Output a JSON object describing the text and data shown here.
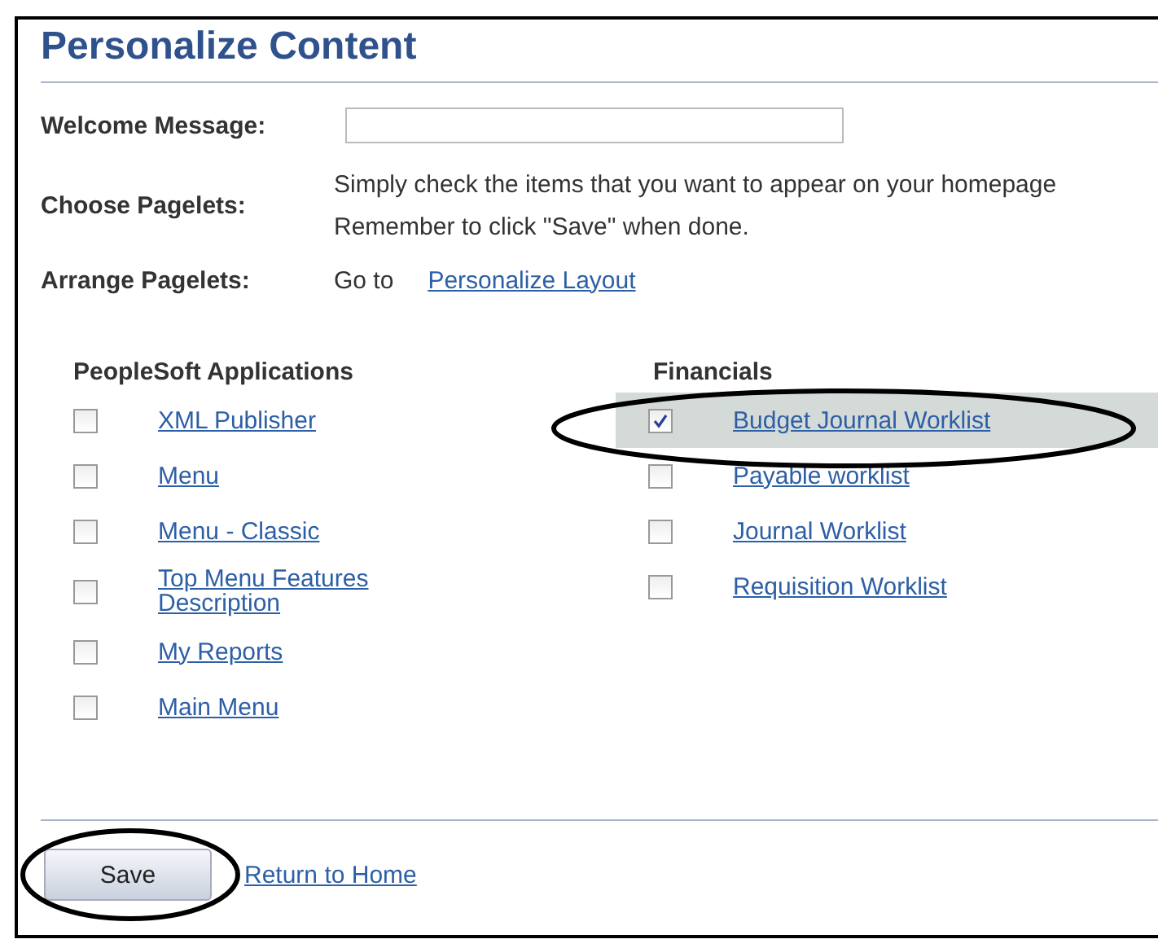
{
  "title": "Personalize Content",
  "welcome": {
    "label": "Welcome Message:"
  },
  "choose": {
    "label": "Choose Pagelets:",
    "lines": [
      "Simply check the items that you want to appear on your homepage",
      "Remember to click \"Save\" when done."
    ]
  },
  "arrange": {
    "label": "Arrange Pagelets:",
    "prefix": "Go to",
    "link": "Personalize Layout"
  },
  "columns": [
    {
      "heading": "PeopleSoft Applications",
      "items": [
        {
          "label": "XML Publisher",
          "checked": false
        },
        {
          "label": "Menu",
          "checked": false
        },
        {
          "label": "Menu - Classic",
          "checked": false
        },
        {
          "label": "Top Menu Features Description",
          "checked": false
        },
        {
          "label": "My Reports",
          "checked": false
        },
        {
          "label": "Main Menu",
          "checked": false
        }
      ]
    },
    {
      "heading": "Financials",
      "items": [
        {
          "label": "Budget Journal Worklist",
          "checked": true
        },
        {
          "label": "Payable worklist",
          "checked": false
        },
        {
          "label": "Journal Worklist",
          "checked": false
        },
        {
          "label": "Requisition Worklist",
          "checked": false
        }
      ]
    }
  ],
  "buttons": {
    "save": "Save",
    "return": "Return to Home"
  }
}
